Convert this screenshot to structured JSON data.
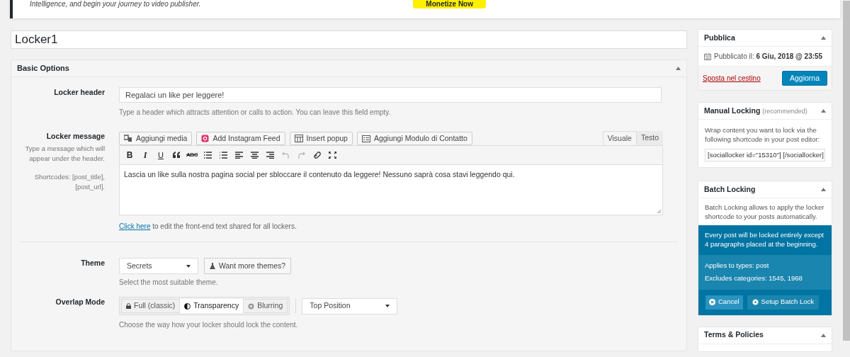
{
  "notice": {
    "text": "Intelligence, and begin your journey to video publisher.",
    "button": "Monetize Now"
  },
  "title_field": {
    "value": "Locker1"
  },
  "basic_options": {
    "title": "Basic Options",
    "locker_header": {
      "label": "Locker header",
      "value": "Regalaci un like per leggere!",
      "hint": "Type a header which attracts attention or calls to action. You can leave this field empty."
    },
    "locker_message": {
      "label": "Locker message",
      "description": "Type a message which will appear under the header.",
      "shortcodes": "Shortcodes: [post_title], [post_url].",
      "media_buttons": [
        "Aggiungi media",
        "Add Instagram Feed",
        "Insert popup",
        "Aggiungi Modulo di Contatto"
      ],
      "editor_tabs": [
        {
          "label": "Visuale",
          "selected": true
        },
        {
          "label": "Testo",
          "selected": false
        }
      ],
      "toolbar_letters": [
        "B",
        "I",
        "U"
      ],
      "strike_label": "ABC",
      "content": "Lascia un like sulla nostra pagina social per sbloccare il contenuto da leggere! Nessuno saprà cosa stavi leggendo qui.",
      "link": "Click here",
      "link_rest": " to edit the front-end text shared for all lockers."
    },
    "theme": {
      "label": "Theme",
      "value": "Secrets",
      "more_button": "Want more themes?",
      "hint": "Select the most suitable theme."
    },
    "overlap_mode": {
      "label": "Overlap Mode",
      "options": [
        {
          "label": "Full (classic)",
          "selected": false
        },
        {
          "label": "Transparency",
          "selected": true
        },
        {
          "label": "Blurring",
          "selected": false
        }
      ],
      "position": "Top Position",
      "hint": "Choose the way how your locker should lock the content."
    }
  },
  "sidebar": {
    "publish": {
      "title": "Pubblica",
      "published_label": "Pubblicato il:",
      "published_date": "6 Giu, 2018 @ 23:55",
      "trash_link": "Sposta nel cestino",
      "update_button": "Aggiorna"
    },
    "manual_locking": {
      "title": "Manual Locking",
      "note": "(recommended)",
      "text": "Wrap content you want to lock via the following shortcode in your post editor:",
      "shortcode": "[sociallocker id=\"15310\"] [/sociallocker]"
    },
    "batch_locking": {
      "title": "Batch Locking",
      "text": "Batch Locking allows to apply the locker shortcode to your posts automatically.",
      "summary": "Every post will be locked entirely except 4 paragraphs placed at the beginning.",
      "applies": "Applies to types: post",
      "excludes": "Excludes categories: 1545, 1968",
      "cancel": "Cancel",
      "setup": "Setup Batch Lock"
    },
    "terms": {
      "title": "Terms & Policies"
    }
  }
}
